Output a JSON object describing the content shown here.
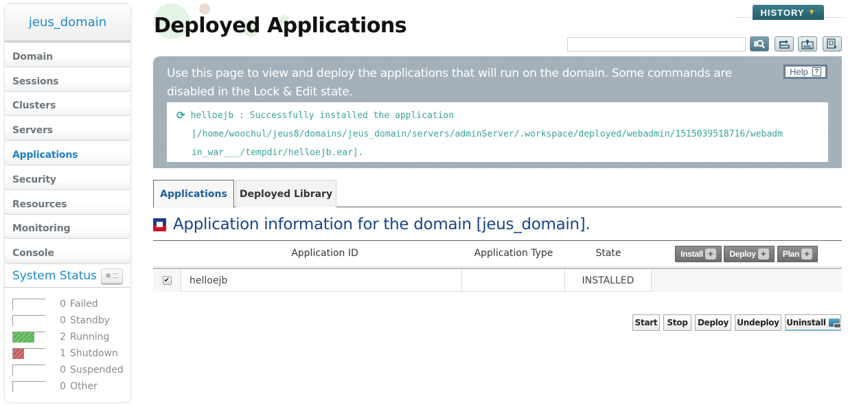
{
  "sidebar": {
    "domain_name": "jeus_domain",
    "nav_items": [
      {
        "label": "Domain",
        "active": false
      },
      {
        "label": "Sessions",
        "active": false
      },
      {
        "label": "Clusters",
        "active": false
      },
      {
        "label": "Servers",
        "active": false
      },
      {
        "label": "Applications",
        "active": true
      },
      {
        "label": "Security",
        "active": false
      },
      {
        "label": "Resources",
        "active": false
      },
      {
        "label": "Monitoring",
        "active": false
      },
      {
        "label": "Console",
        "active": false
      }
    ],
    "system_status": {
      "title": "System Status",
      "icon": "status-toggle-icon",
      "items": [
        {
          "count": "0",
          "label": "Failed",
          "fraction": 0,
          "color": "none"
        },
        {
          "count": "0",
          "label": "Standby",
          "fraction": 0,
          "color": "none"
        },
        {
          "count": "2",
          "label": "Running",
          "fraction": 0.67,
          "color": "green"
        },
        {
          "count": "1",
          "label": "Shutdown",
          "fraction": 0.33,
          "color": "red"
        },
        {
          "count": "0",
          "label": "Suspended",
          "fraction": 0,
          "color": "none"
        },
        {
          "count": "0",
          "label": "Other",
          "fraction": 0,
          "color": "none"
        }
      ]
    }
  },
  "header": {
    "title": "Deployed Applications",
    "history_label": "HISTORY",
    "search_value": "",
    "tool_icons": [
      "search-icon",
      "refresh-icon",
      "xml-export-icon",
      "report-icon"
    ]
  },
  "info": {
    "description": "Use this page to view and deploy the applications that will run on the domain. Some commands are disabled in the Lock & Edit state.",
    "help_label": "Help",
    "message": {
      "line1": "helloejb : Successfully installed the application",
      "line2": "[/home/woochul/jeus8/domains/jeus_domain/servers/adminServer/.workspace/deployed/webadmin/1515039518716/webadm",
      "line3": "in_war___/tempdir/helloejb.ear]."
    }
  },
  "tabs": [
    {
      "label": "Applications",
      "active": true
    },
    {
      "label": "Deployed Library",
      "active": false
    }
  ],
  "section": {
    "title": "Application information for the domain [jeus_domain]."
  },
  "table": {
    "columns": [
      "Application ID",
      "Application Type",
      "State"
    ],
    "header_buttons": [
      "Install",
      "Deploy",
      "Plan"
    ],
    "rows": [
      {
        "checked": true,
        "id": "helloejb",
        "type": "",
        "state": "INSTALLED"
      }
    ]
  },
  "actions": {
    "start": "Start",
    "stop": "Stop",
    "deploy": "Deploy",
    "undeploy": "Undeploy",
    "uninstall": "Uninstall"
  },
  "colors": {
    "accent_blue": "#1a87d2",
    "title_blue": "#17448a",
    "info_panel": "#a3afb8",
    "message_teal": "#3aa39a",
    "history_teal": "#2f6e78",
    "running_green": "#5fb55a",
    "shutdown_red": "#c55a5a"
  }
}
